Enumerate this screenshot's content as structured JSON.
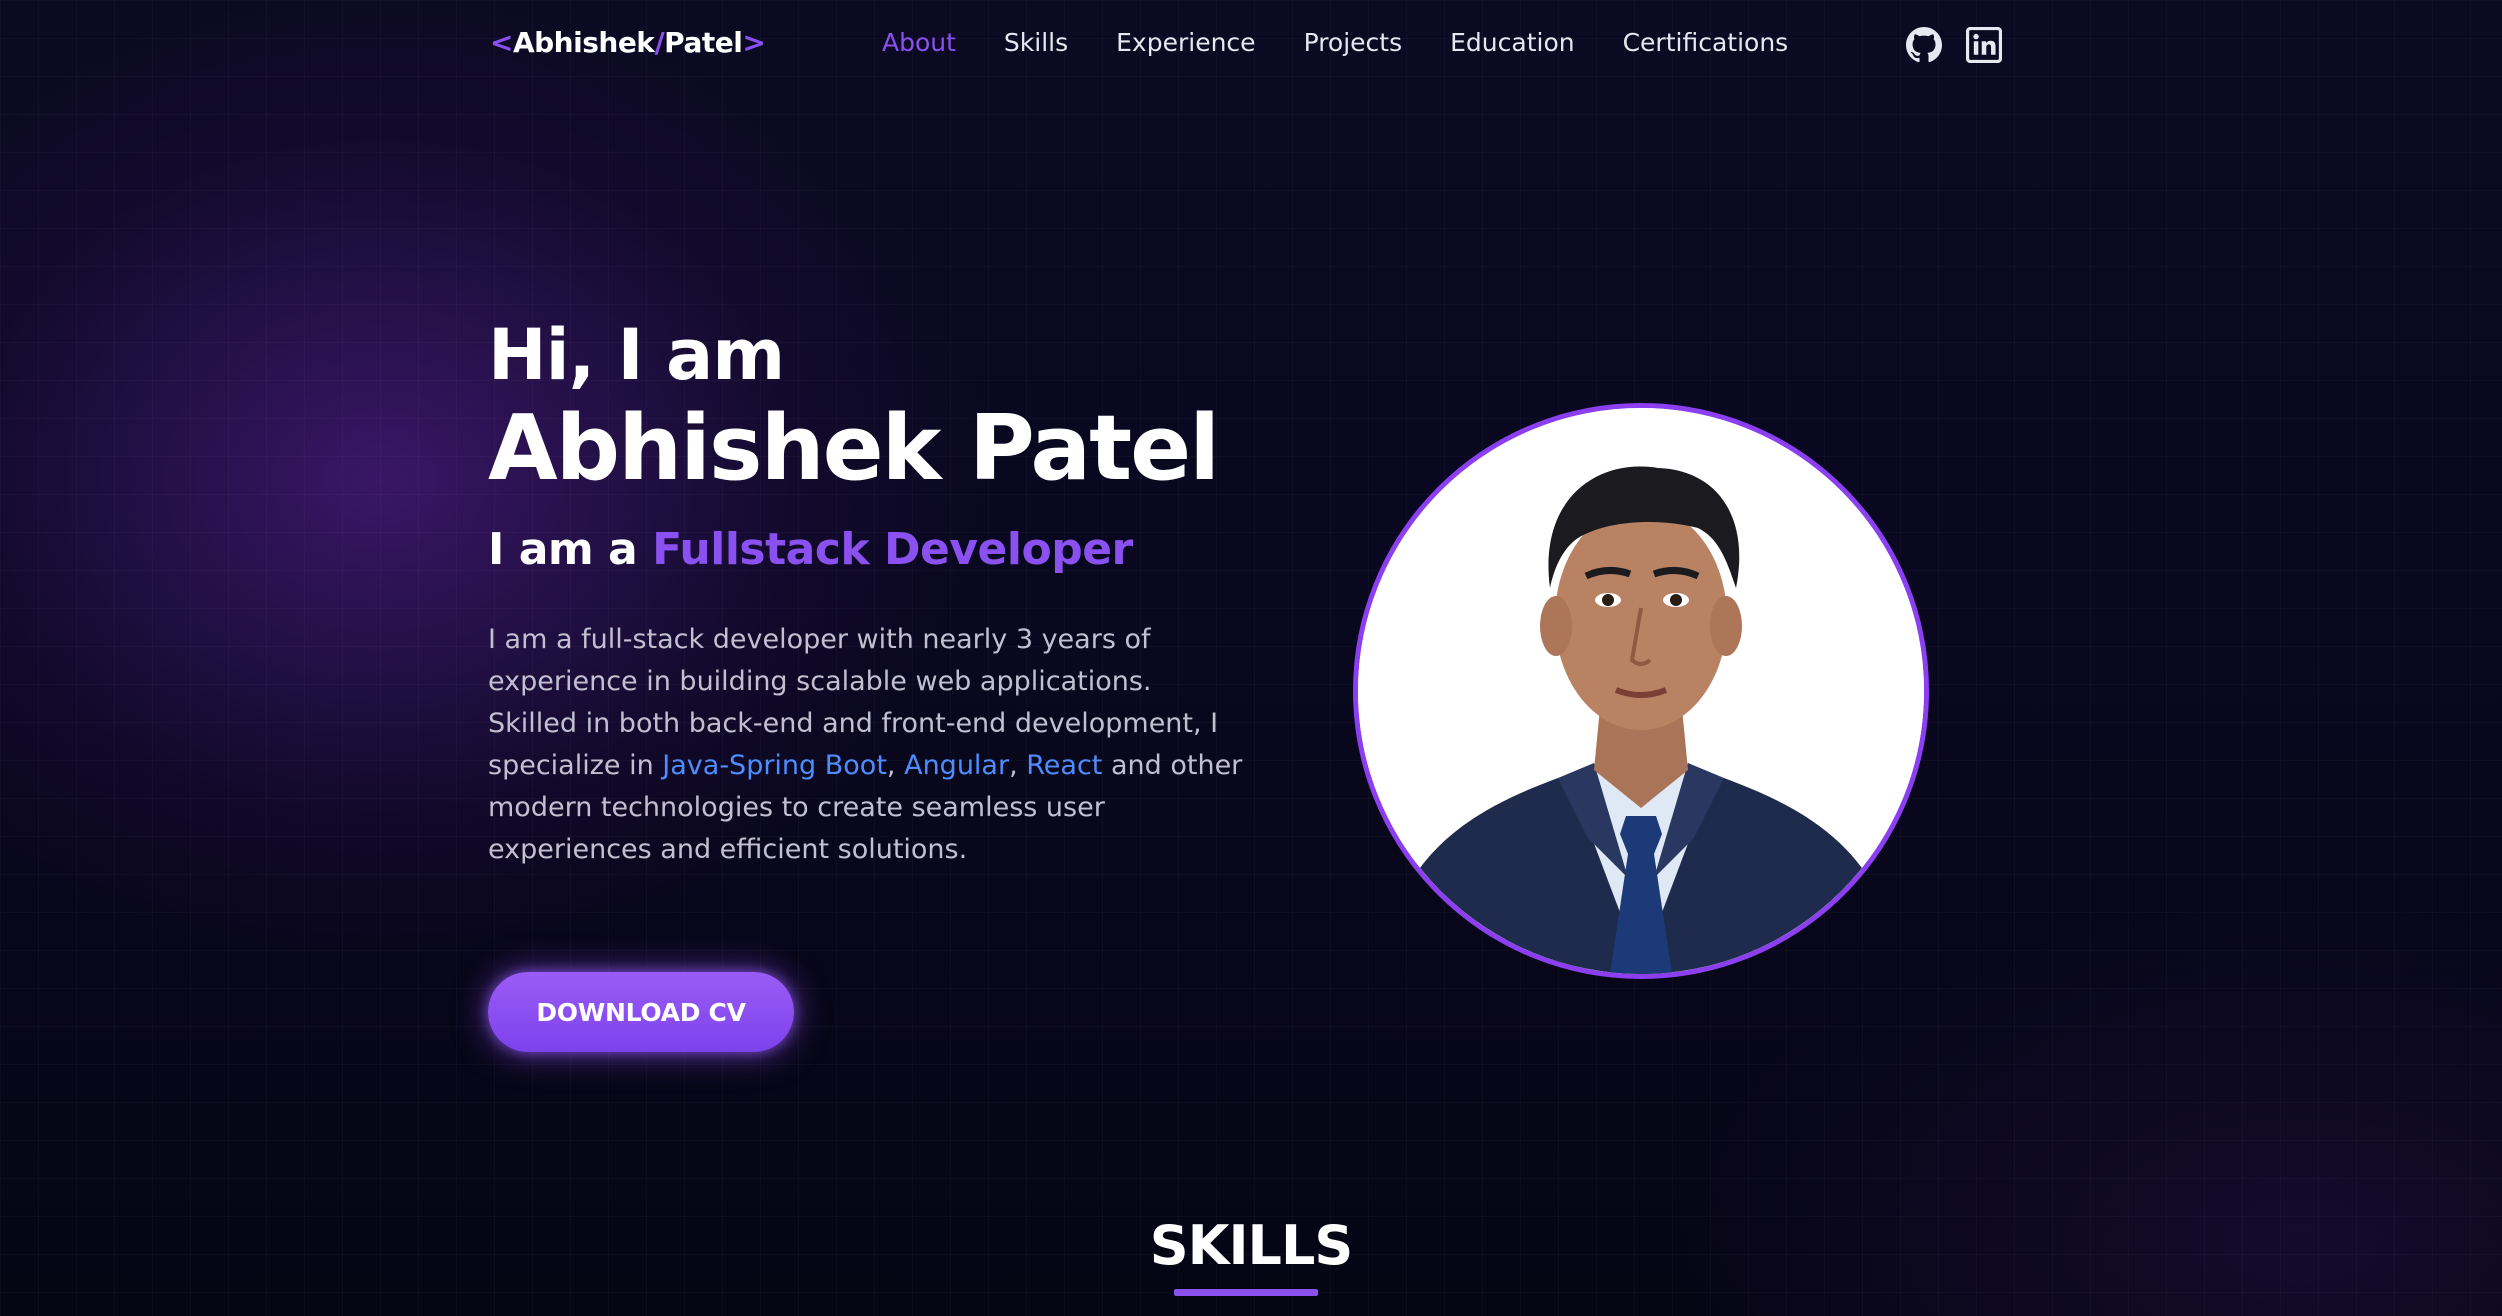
{
  "logo": {
    "open": "<",
    "first": "Abhishek",
    "slash": "/",
    "last": "Patel",
    "close": ">"
  },
  "nav": {
    "items": [
      "About",
      "Skills",
      "Experience",
      "Projects",
      "Education",
      "Certifications"
    ],
    "active_index": 0,
    "social": [
      "github-icon",
      "linkedin-icon"
    ]
  },
  "hero": {
    "greeting": "Hi, I am",
    "name": "Abhishek Patel",
    "role_prefix": "I am a ",
    "role": "Fullstack Developer",
    "description": {
      "part1": "I am a full-stack developer with nearly 3 years of experience in building scalable web applications. Skilled in both back-end and front-end development, I specialize in ",
      "tech1": "Java-Spring Boot",
      "sep1": ", ",
      "tech2": "Angular",
      "sep2": ", ",
      "tech3": "React",
      "part2": " and other modern technologies to create seamless user experiences and efficient solutions."
    },
    "cta": "DOWNLOAD CV"
  },
  "skills": {
    "title": "SKILLS"
  },
  "colors": {
    "accent": "#8b50f0",
    "link": "#4d8dff",
    "background": "#07061a",
    "text": "#ffffff",
    "muted": "#c2bfd0"
  }
}
